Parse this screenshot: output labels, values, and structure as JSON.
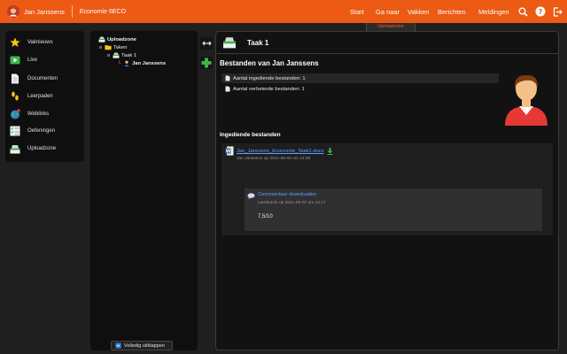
{
  "topbar": {
    "user_name": "Jan Janssens",
    "course": "Economie 6ECO",
    "nav": [
      "Start",
      "Ga naar",
      "Vakken",
      "Berichten",
      "Meldingen"
    ],
    "icons": [
      "search-icon",
      "help-icon",
      "logout-icon"
    ],
    "tab_label": "Uploadzone",
    "bar_color": "#ec5a14"
  },
  "leftmenu": {
    "items": [
      {
        "label": "Vaknieuws",
        "icon": "star-icon"
      },
      {
        "label": "Live",
        "icon": "live-video-icon"
      },
      {
        "label": "Documenten",
        "icon": "document-icon"
      },
      {
        "label": "Leerpaden",
        "icon": "footsteps-icon"
      },
      {
        "label": "Weblinks",
        "icon": "globe-icon"
      },
      {
        "label": "Oefeningen",
        "icon": "exercises-icon"
      },
      {
        "label": "Uploadzone",
        "icon": "upload-tray-icon"
      }
    ]
  },
  "tree": {
    "root": "Uploadzone",
    "taken": "Taken",
    "task": "Taak 1",
    "student": "Jan Janssens",
    "expand_all": "Volledig uitklappen"
  },
  "main": {
    "task_title": "Taak 1",
    "files_title": "Bestanden van Jan Janssens",
    "stats": [
      "Aantal ingediende bestanden: 1",
      "Aantal verbeterde bestanden: 1"
    ],
    "submitted_title": "Ingediende bestanden",
    "file": {
      "name": "Jan_Janssens_Economie_Taak1.docx",
      "meta": "Jan Janssens op 2021-06-06 om 14:09"
    },
    "comment": {
      "link": "Commentaar downloaden",
      "meta": "Leerkracht op 2021-06-07 om 16:17",
      "grade": "7,5/10"
    }
  }
}
